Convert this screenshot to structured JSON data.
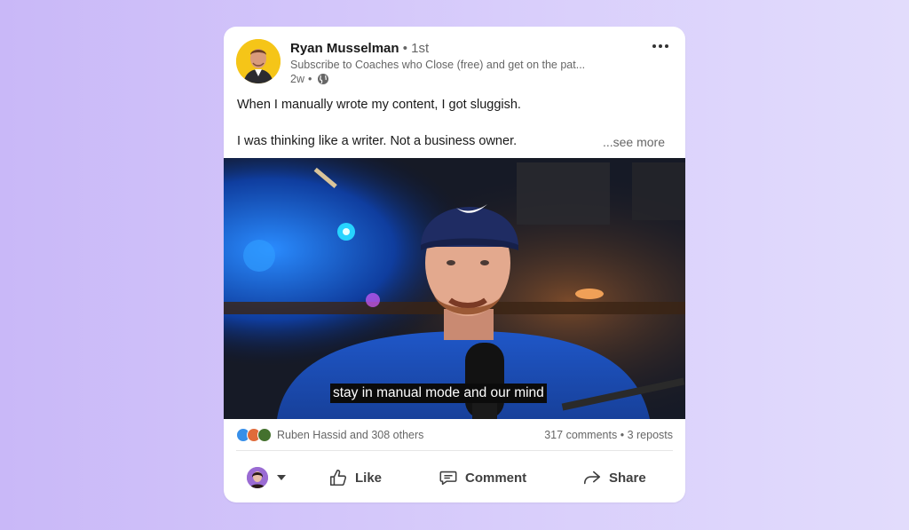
{
  "post": {
    "author_name": "Ryan Musselman",
    "separator": "•",
    "degree": "1st",
    "headline": "Subscribe to Coaches who Close (free) and get on the pat...",
    "time": "2w",
    "time_separator": "•",
    "visibility_icon": "globe-icon",
    "more_icon": "more-horizontal-icon",
    "text_line1": "When I manually wrote my content, I got sluggish.",
    "text_line2": "I was thinking like a writer. Not a business owner.",
    "see_more": "...see more"
  },
  "video": {
    "caption": "stay in manual mode and our mind"
  },
  "social": {
    "reaction_icons": [
      "like-reaction-icon",
      "celebrate-reaction-icon",
      "insightful-reaction-icon"
    ],
    "reactors": "Ruben Hassid and 308 others",
    "comments": "317 comments",
    "separator": "•",
    "reposts": "3 reposts"
  },
  "actions": {
    "like": "Like",
    "comment": "Comment",
    "share": "Share"
  },
  "colors": {
    "background_left": "#c9b8f8",
    "background_right": "#e2dcfc",
    "card": "#ffffff",
    "text_primary": "#191919",
    "text_secondary": "#666666",
    "avatar_bg": "#f5c518"
  }
}
